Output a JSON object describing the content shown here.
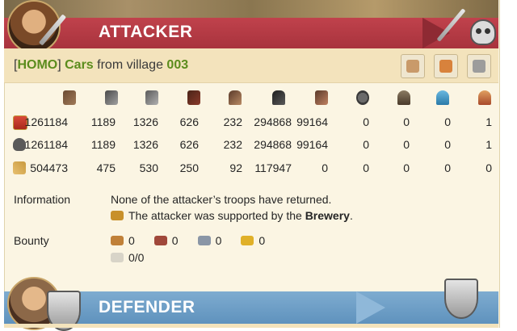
{
  "attacker": {
    "title": "ATTACKER",
    "player_tag": "HOMO",
    "player_name": "Cars",
    "from_text": "from village",
    "village": "003",
    "header_buttons": [
      "send-troops-icon",
      "report-icon",
      "simulate-icon"
    ]
  },
  "units": [
    "club",
    "spear",
    "axe",
    "boot",
    "horse",
    "warhorse",
    "ram",
    "catapult",
    "chief",
    "settler",
    "hero"
  ],
  "rows": [
    {
      "type": "troops",
      "icon": "troops-icon",
      "values": [
        "1261184",
        "1189",
        "1326",
        "626",
        "232",
        "294868",
        "99164",
        "0",
        "0",
        "0",
        "1"
      ]
    },
    {
      "type": "losses",
      "icon": "skull-icon",
      "values": [
        "1261184",
        "1189",
        "1326",
        "626",
        "232",
        "294868",
        "99164",
        "0",
        "0",
        "0",
        "1"
      ]
    },
    {
      "type": "healed",
      "icon": "bandage-icon",
      "values": [
        "504473",
        "475",
        "530",
        "250",
        "92",
        "117947",
        "0",
        "0",
        "0",
        "0",
        "0"
      ]
    }
  ],
  "information": {
    "label": "Information",
    "line1": "None of the attacker’s troops have returned.",
    "line2_prefix": "The attacker was supported by the ",
    "line2_bold": "Brewery",
    "line2_suffix": "."
  },
  "bounty": {
    "label": "Bounty",
    "wood": "0",
    "clay": "0",
    "iron": "0",
    "crop": "0",
    "capacity": "0/0"
  },
  "defender": {
    "title": "DEFENDER"
  },
  "colors": {
    "attacker_band": "#b03a44",
    "defender_band": "#6c9ec6",
    "accent_green": "#5b8c1d",
    "panel_bg": "#fbf5e3"
  }
}
